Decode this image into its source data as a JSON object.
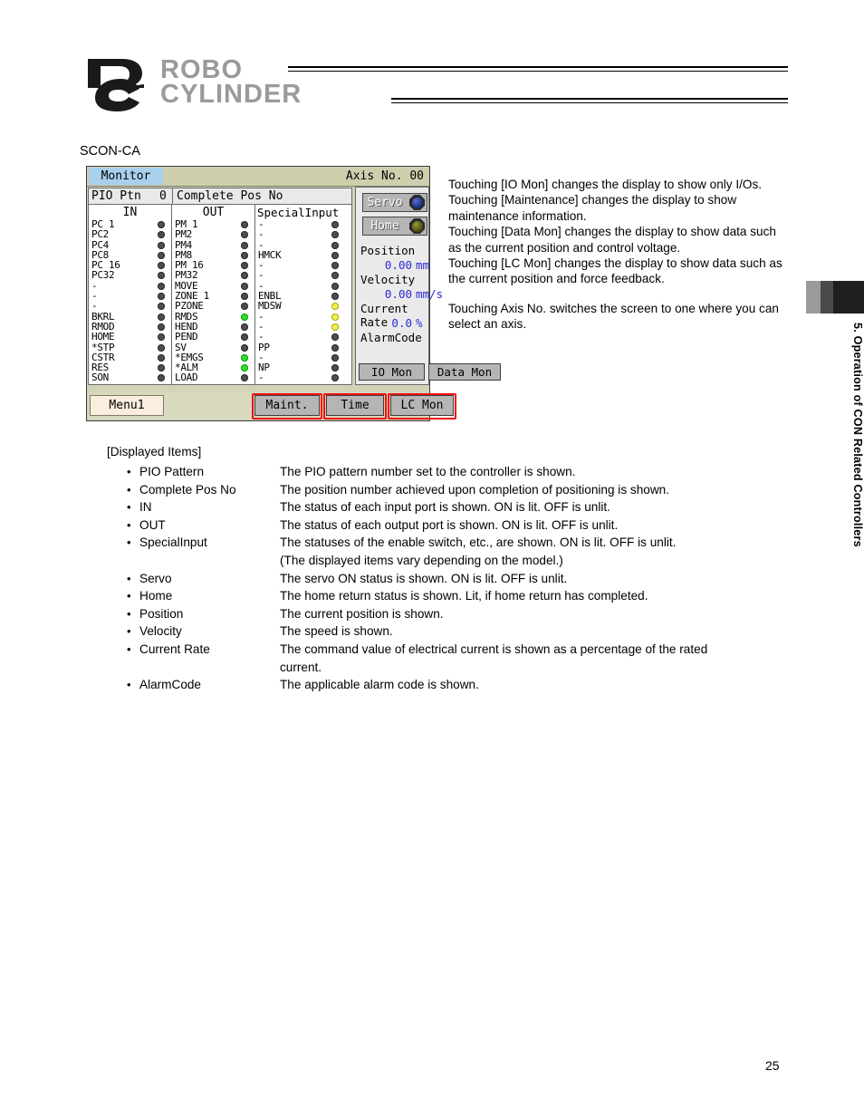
{
  "header": {
    "logo_line1": "ROBO",
    "logo_line2": "CYLINDER",
    "logo_mark": "rc-logo-icon"
  },
  "caption": "SCON-CA",
  "lcd": {
    "titlebar": {
      "title": "Monitor",
      "axis": "Axis No. 00"
    },
    "ptn_row": {
      "label": "PIO Ptn",
      "value": "0",
      "complete_pos_no": "Complete Pos No"
    },
    "columns": {
      "in_header": "IN",
      "out_header": "OUT",
      "special_header": "SpecialInput"
    },
    "in_rows": [
      {
        "name": "PC 1",
        "led": "off"
      },
      {
        "name": "PC2",
        "led": "off"
      },
      {
        "name": "PC4",
        "led": "off"
      },
      {
        "name": "PC8",
        "led": "off"
      },
      {
        "name": "PC 16",
        "led": "off"
      },
      {
        "name": "PC32",
        "led": "off"
      },
      {
        "name": "-",
        "led": "off"
      },
      {
        "name": "-",
        "led": "off"
      },
      {
        "name": "-",
        "led": "off"
      },
      {
        "name": "BKRL",
        "led": "off"
      },
      {
        "name": "RMOD",
        "led": "off"
      },
      {
        "name": "HOME",
        "led": "off"
      },
      {
        "name": "*STP",
        "led": "off"
      },
      {
        "name": "CSTR",
        "led": "off"
      },
      {
        "name": "RES",
        "led": "off"
      },
      {
        "name": "SON",
        "led": "off"
      }
    ],
    "out_rows": [
      {
        "name": "PM 1",
        "led": "off"
      },
      {
        "name": "PM2",
        "led": "off"
      },
      {
        "name": "PM4",
        "led": "off"
      },
      {
        "name": "PM8",
        "led": "off"
      },
      {
        "name": "PM 16",
        "led": "off"
      },
      {
        "name": "PM32",
        "led": "off"
      },
      {
        "name": "MOVE",
        "led": "off"
      },
      {
        "name": "ZONE 1",
        "led": "off"
      },
      {
        "name": "PZONE",
        "led": "off"
      },
      {
        "name": "RMDS",
        "led": "green"
      },
      {
        "name": "HEND",
        "led": "off"
      },
      {
        "name": "PEND",
        "led": "off"
      },
      {
        "name": "SV",
        "led": "off"
      },
      {
        "name": "*EMGS",
        "led": "green"
      },
      {
        "name": "*ALM",
        "led": "green"
      },
      {
        "name": "LOAD",
        "led": "off"
      }
    ],
    "special_rows": [
      {
        "name": "-",
        "led": "off"
      },
      {
        "name": "-",
        "led": "off"
      },
      {
        "name": "-",
        "led": "off"
      },
      {
        "name": "HMCK",
        "led": "off"
      },
      {
        "name": "-",
        "led": "off"
      },
      {
        "name": "-",
        "led": "off"
      },
      {
        "name": "-",
        "led": "off"
      },
      {
        "name": "ENBL",
        "led": "off"
      },
      {
        "name": "MDSW",
        "led": "yellow"
      },
      {
        "name": "-",
        "led": "yellow"
      },
      {
        "name": "-",
        "led": "yellow"
      },
      {
        "name": "-",
        "led": "off"
      },
      {
        "name": "PP",
        "led": "off"
      },
      {
        "name": "-",
        "led": "off"
      },
      {
        "name": "NP",
        "led": "off"
      },
      {
        "name": "-",
        "led": "off"
      }
    ],
    "status": {
      "servo_label": "Servo",
      "servo_lamp": "blue",
      "home_label": "Home",
      "home_lamp": "olive"
    },
    "readouts": {
      "position_label": "Position",
      "position_value": "0.00",
      "position_unit": "mm",
      "velocity_label": "Velocity",
      "velocity_value": "0.00",
      "velocity_unit": "mm/s",
      "current_rate_label": "Current Rate",
      "current_rate_value": "0.0",
      "current_rate_unit": "%",
      "alarm_code_label": "AlarmCode"
    },
    "panel_buttons": {
      "io_mon": "IO Mon",
      "data_mon": "Data Mon"
    },
    "bottom_buttons": {
      "menu1": "Menu1",
      "maint": "Maint.",
      "time": "Time",
      "lc_mon": "LC Mon"
    },
    "highlight_color": "#ee1111"
  },
  "right_text": {
    "p1": "Touching [IO Mon] changes the display to show only I/Os.",
    "p2": "Touching [Maintenance] changes the display to show maintenance information.",
    "p3": "Touching [Data Mon] changes the display to show data such as the current position and control voltage.",
    "p4": "Touching [LC Mon] changes the display to show data such as the current position and force feedback.",
    "p5": "Touching Axis No. switches the screen to one where you can select an axis."
  },
  "displayed_items": {
    "heading": "[Displayed Items]",
    "bullet": "•",
    "items": [
      {
        "name": "PIO Pattern",
        "desc": "The PIO pattern number set to the controller is shown.",
        "desc2": ""
      },
      {
        "name": "Complete Pos No",
        "desc": "The position number achieved upon completion of positioning is shown.",
        "desc2": ""
      },
      {
        "name": "IN",
        "desc": "The status of each input port is shown. ON is lit. OFF is unlit.",
        "desc2": ""
      },
      {
        "name": "OUT",
        "desc": "The status of each output port is shown. ON is lit. OFF is unlit.",
        "desc2": ""
      },
      {
        "name": "SpecialInput",
        "desc": "The statuses of the enable switch, etc., are shown. ON is lit. OFF is unlit.",
        "desc2": "(The displayed items vary depending on the model.)"
      },
      {
        "name": "Servo",
        "desc": "The servo ON status is shown. ON is lit. OFF is unlit.",
        "desc2": ""
      },
      {
        "name": "Home",
        "desc": "The home return status is shown. Lit, if home return has completed.",
        "desc2": ""
      },
      {
        "name": "Position",
        "desc": "The current position is shown.",
        "desc2": ""
      },
      {
        "name": "Velocity",
        "desc": "The speed is shown.",
        "desc2": ""
      },
      {
        "name": "Current Rate",
        "desc": "The command value of electrical current is shown as a percentage of the rated",
        "desc2": "current."
      },
      {
        "name": "AlarmCode",
        "desc": "The applicable alarm code is shown.",
        "desc2": ""
      }
    ]
  },
  "side_tab": {
    "text": "5. Operation of CON Related Controllers"
  },
  "page_number": "25"
}
